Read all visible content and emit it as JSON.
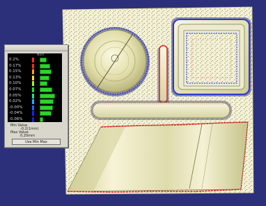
{
  "color_scale": {
    "values": [
      "0.2%",
      "0.17%",
      "0.15%",
      "0.13%",
      "0.10%",
      "0.07%",
      "0.05%",
      "0.02%",
      "-0.00%",
      "-0.04%",
      "-0.06%"
    ],
    "swatch_colors": [
      "#ff2a2a",
      "#ff2a2a",
      "#ffa020",
      "#ffe020",
      "#a0ff20",
      "#20e020",
      "#20e0a0",
      "#20b0ff",
      "#2060ff",
      "#2020ff",
      "#2020b0"
    ],
    "bar_fractions": [
      0.32,
      0.5,
      0.55,
      0.45,
      0.35,
      0.6,
      0.72,
      0.68,
      0.62,
      0.55,
      0.18
    ],
    "header_mark": "Nom"
  },
  "min_value": {
    "label": "Min Value",
    "value": "-0.2(1mm)"
  },
  "max_value": {
    "label": "Max Value",
    "value": "0.20mm"
  },
  "minmax_button": "Use Min Max",
  "colors": {
    "background": "#2c2f7a",
    "part_surface": "#f1efcb",
    "deviation_high": "#e82020",
    "deviation_low": "#2a3ad0"
  }
}
